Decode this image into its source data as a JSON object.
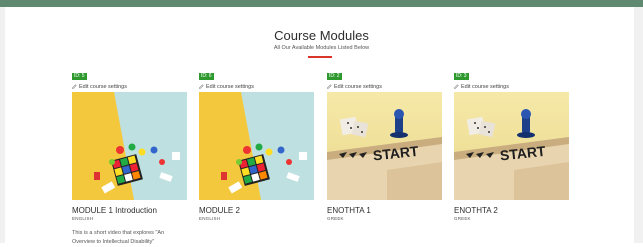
{
  "header": {
    "title": "Course Modules",
    "subtitle": "All Our Available Modules Listed Below"
  },
  "colors": {
    "topbar": "#5f8a6f",
    "badge": "#2e9a2e",
    "accent_underline": "#d9362b"
  },
  "cards": [
    {
      "badge": "ID: 5",
      "edit_label": "Edit course settings",
      "image_icon": "dice-and-game-pieces-image",
      "title": "MODULE 1 Introduction",
      "language": "ENGLISH",
      "description": "This is a short video that explores \"An Overview to Intellectual Disability\""
    },
    {
      "badge": "ID: 6",
      "edit_label": "Edit course settings",
      "image_icon": "dice-and-game-pieces-image",
      "title": "MODULE 2",
      "language": "ENGLISH",
      "description": ""
    },
    {
      "badge": "ID: 2",
      "edit_label": "Edit course settings",
      "image_icon": "board-game-start-image",
      "title": "ENOTHTA 1",
      "language": "GREEK",
      "description": ""
    },
    {
      "badge": "ID: 3",
      "edit_label": "Edit course settings",
      "image_icon": "board-game-start-image",
      "title": "ENOTHTA 2",
      "language": "GREEK",
      "description": ""
    }
  ]
}
